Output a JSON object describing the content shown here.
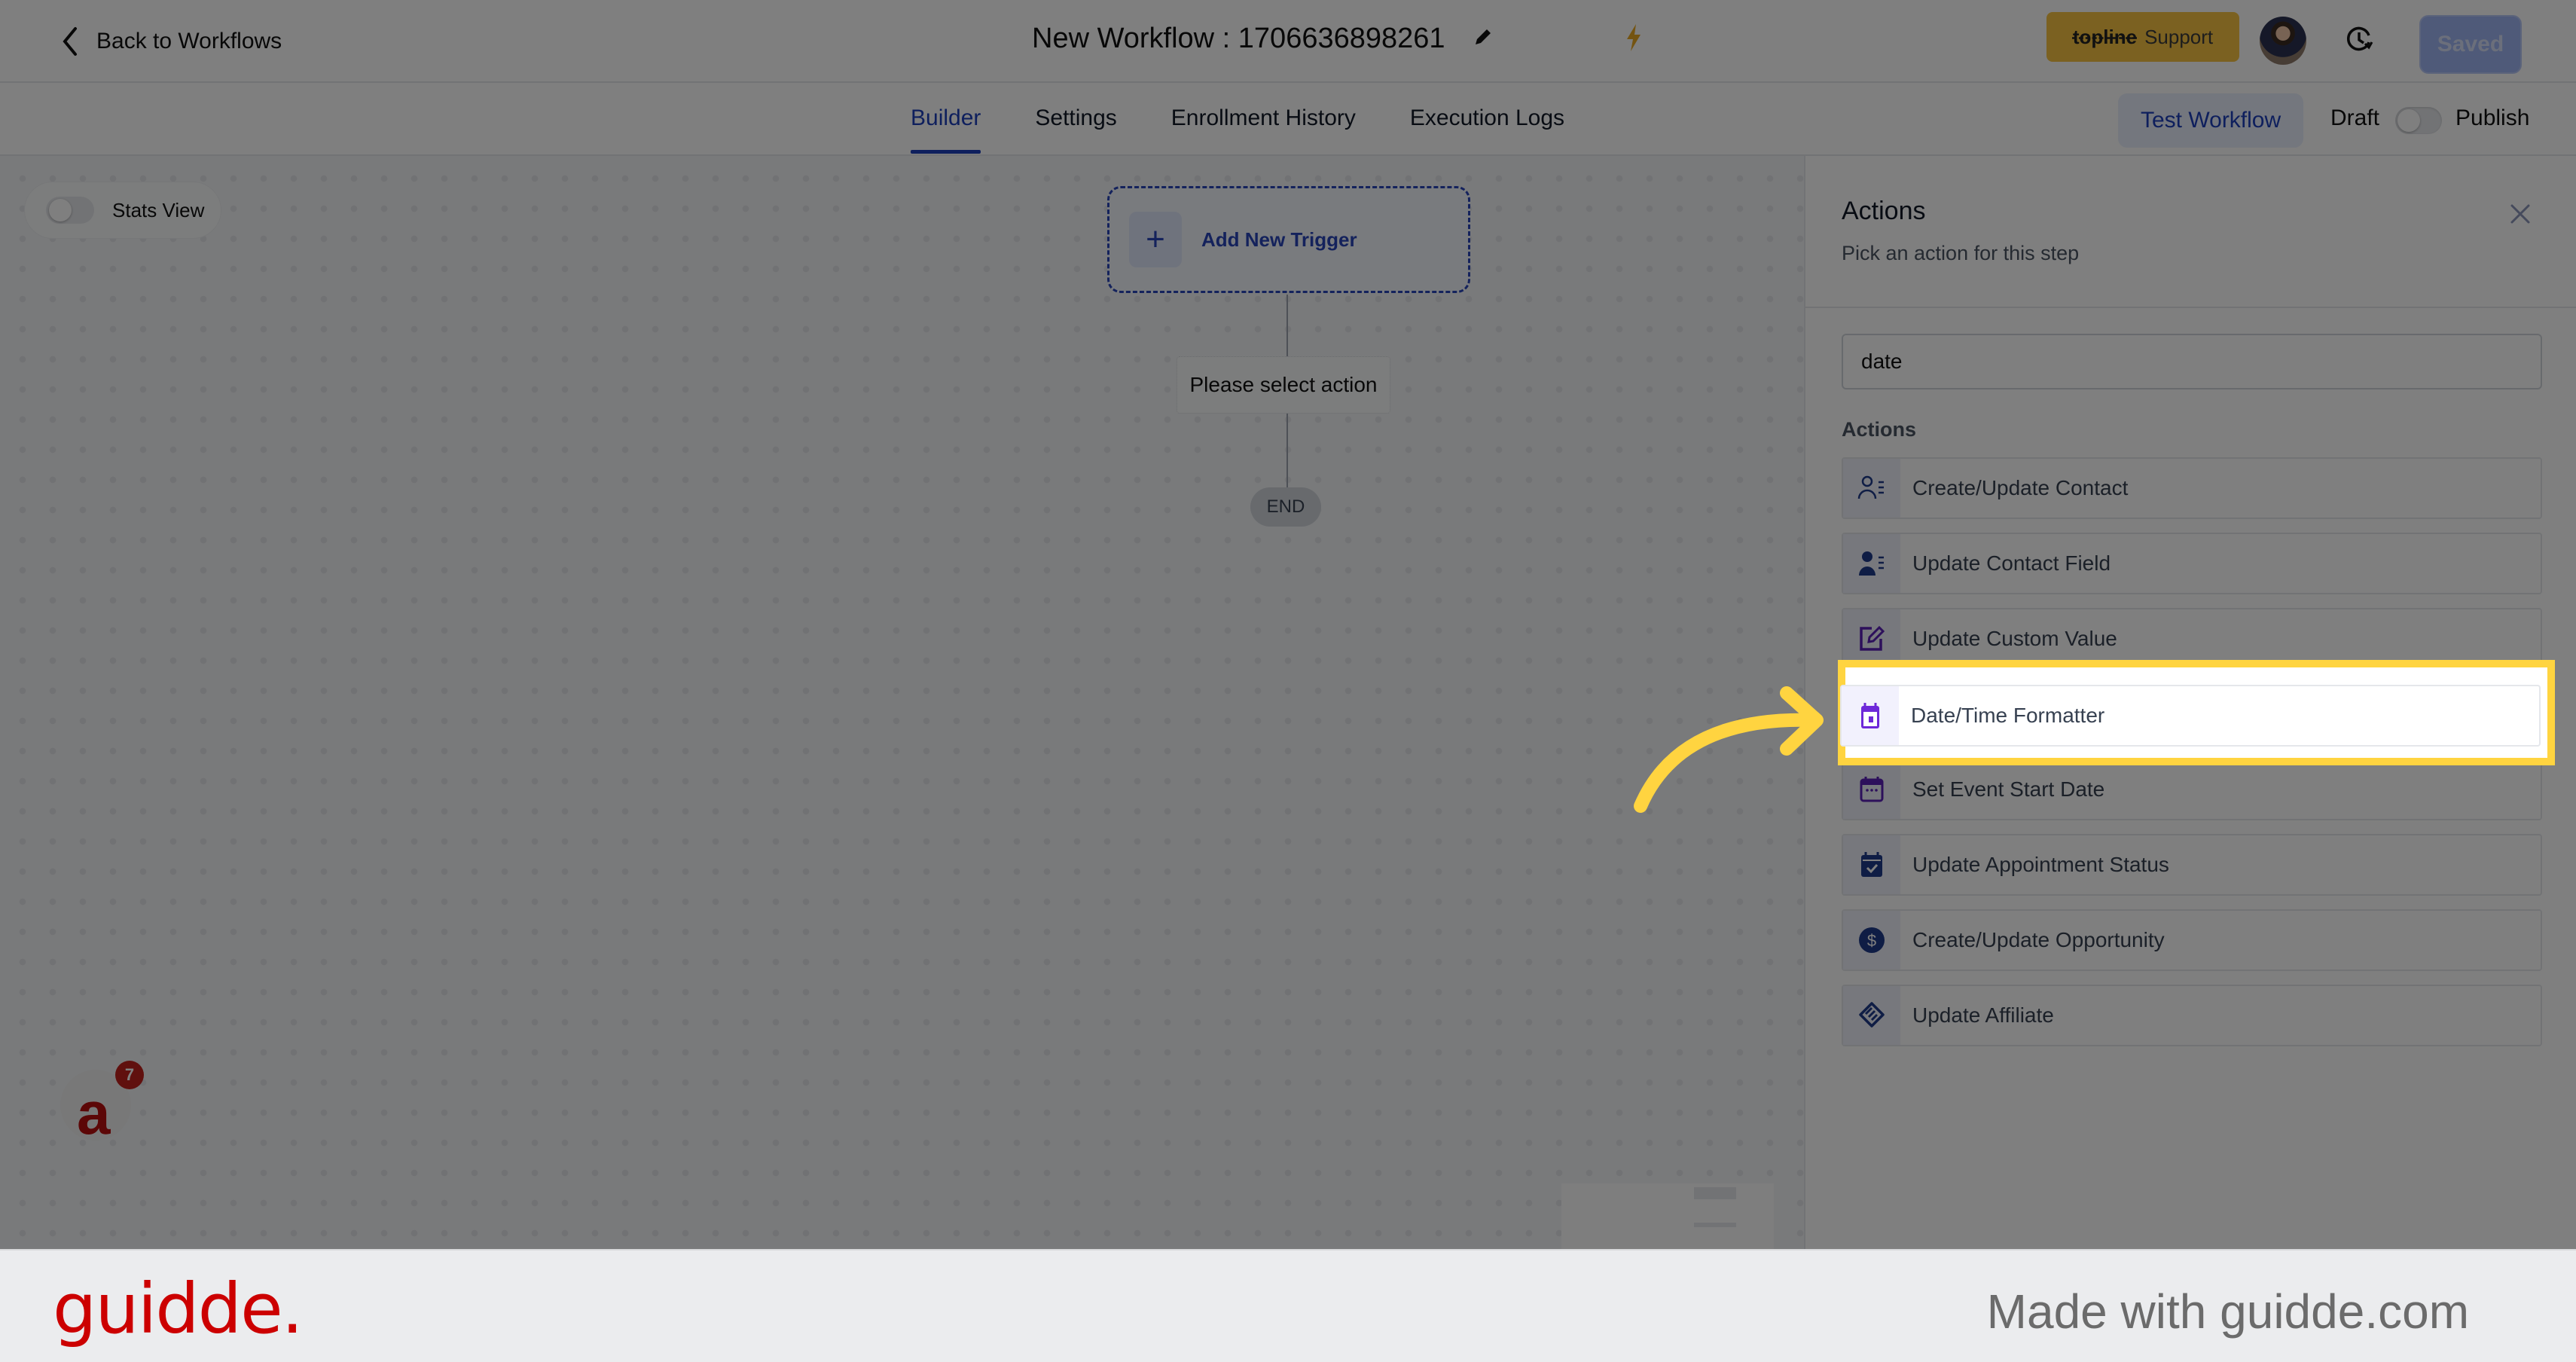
{
  "header": {
    "back_label": "Back to Workflows",
    "workflow_title": "New Workflow : 1706636898261",
    "support_brand": "topline",
    "support_label": "Support",
    "saved_label": "Saved"
  },
  "tabs": [
    {
      "label": "Builder",
      "active": true
    },
    {
      "label": "Settings",
      "active": false
    },
    {
      "label": "Enrollment History",
      "active": false
    },
    {
      "label": "Execution Logs",
      "active": false
    }
  ],
  "toolbar": {
    "test_workflow_label": "Test Workflow",
    "draft_label": "Draft",
    "publish_label": "Publish",
    "published": false
  },
  "canvas": {
    "stats_view_label": "Stats View",
    "stats_view_on": false,
    "add_trigger_label": "Add New Trigger",
    "placeholder_action_label": "Please select action",
    "end_label": "END",
    "chat_badge_count": "7"
  },
  "panel": {
    "title": "Actions",
    "subtitle": "Pick an action for this step",
    "search_value": "date",
    "section_label": "Actions",
    "items": [
      {
        "label": "Create/Update Contact",
        "icon": "contact-outline-icon",
        "color": "#1e3a8a"
      },
      {
        "label": "Update Contact Field",
        "icon": "contact-solid-icon",
        "color": "#1e3a8a"
      },
      {
        "label": "Update Custom Value",
        "icon": "edit-icon",
        "color": "#5b21b6"
      },
      {
        "label": "Date/Time Formatter",
        "icon": "calendar-icon",
        "color": "#6d28d9",
        "highlighted": true
      },
      {
        "label": "Set Event Start Date",
        "icon": "calendar-dots-icon",
        "color": "#5b21b6"
      },
      {
        "label": "Update Appointment Status",
        "icon": "calendar-check-icon",
        "color": "#1e3a8a"
      },
      {
        "label": "Create/Update Opportunity",
        "icon": "dollar-icon",
        "color": "#1e3a8a"
      },
      {
        "label": "Update Affiliate",
        "icon": "handshake-icon",
        "color": "#1e3a8a"
      }
    ]
  },
  "footer": {
    "logo": "guidde.",
    "made_with": "Made with guidde.com"
  },
  "colors": {
    "accent": "#1d3fbb",
    "highlight": "#ffd440",
    "support": "#f6c342",
    "brand_red": "#cc0000"
  }
}
